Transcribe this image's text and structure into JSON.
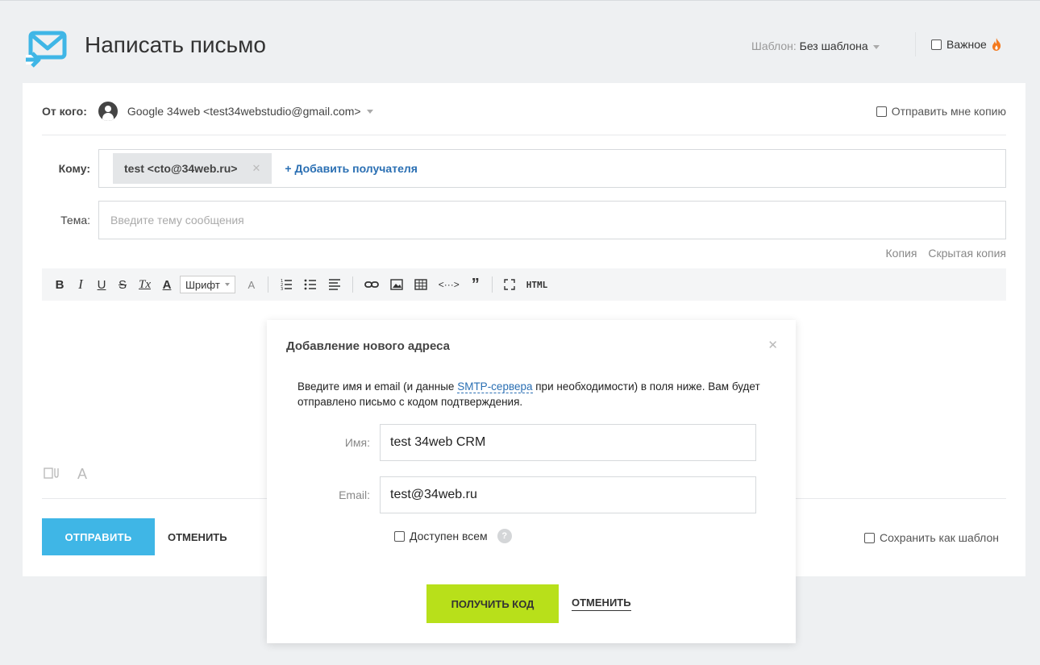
{
  "header": {
    "title": "Написать письмо",
    "template_label": "Шаблон:",
    "template_value": "Без шаблона",
    "important_label": "Важное"
  },
  "from": {
    "label": "От кого:",
    "value": "Google 34web <test34webstudio@gmail.com>",
    "copy_me_label": "Отправить мне копию"
  },
  "to": {
    "label": "Кому:",
    "recipient": "test <cto@34web.ru>",
    "add_label": "+ Добавить получателя"
  },
  "subject": {
    "label": "Тема:",
    "placeholder": "Введите тему сообщения",
    "value": ""
  },
  "cc": {
    "copy_label": "Копия",
    "bcc_label": "Скрытая копия"
  },
  "toolbar": {
    "bold": "B",
    "italic": "I",
    "underline": "U",
    "strike": "S",
    "clear_format": "Tx",
    "font_color": "A",
    "font_select": "Шрифт",
    "font_size": "A",
    "html": "HTML"
  },
  "footer": {
    "send_label": "ОТПРАВИТЬ",
    "cancel_label": "ОТМЕНИТЬ",
    "save_template_label": "Сохранить как шаблон"
  },
  "modal": {
    "title": "Добавление нового адреса",
    "text_before": "Введите имя и email (и данные ",
    "text_link": "SMTP-сервера",
    "text_after": " при необходимости) в поля ниже. Вам будет отправлено письмо с кодом подтверждения.",
    "name_label": "Имя:",
    "name_value": "test 34web CRM",
    "email_label": "Email:",
    "email_value": "test@34web.ru",
    "available_label": "Доступен всем",
    "get_code_label": "ПОЛУЧИТЬ КОД",
    "cancel_label": "ОТМЕНИТЬ"
  },
  "colors": {
    "accent_blue": "#3fb6e6",
    "accent_green": "#b8e01a",
    "link_blue": "#2a6fb3",
    "flame": "#f47a1f"
  }
}
